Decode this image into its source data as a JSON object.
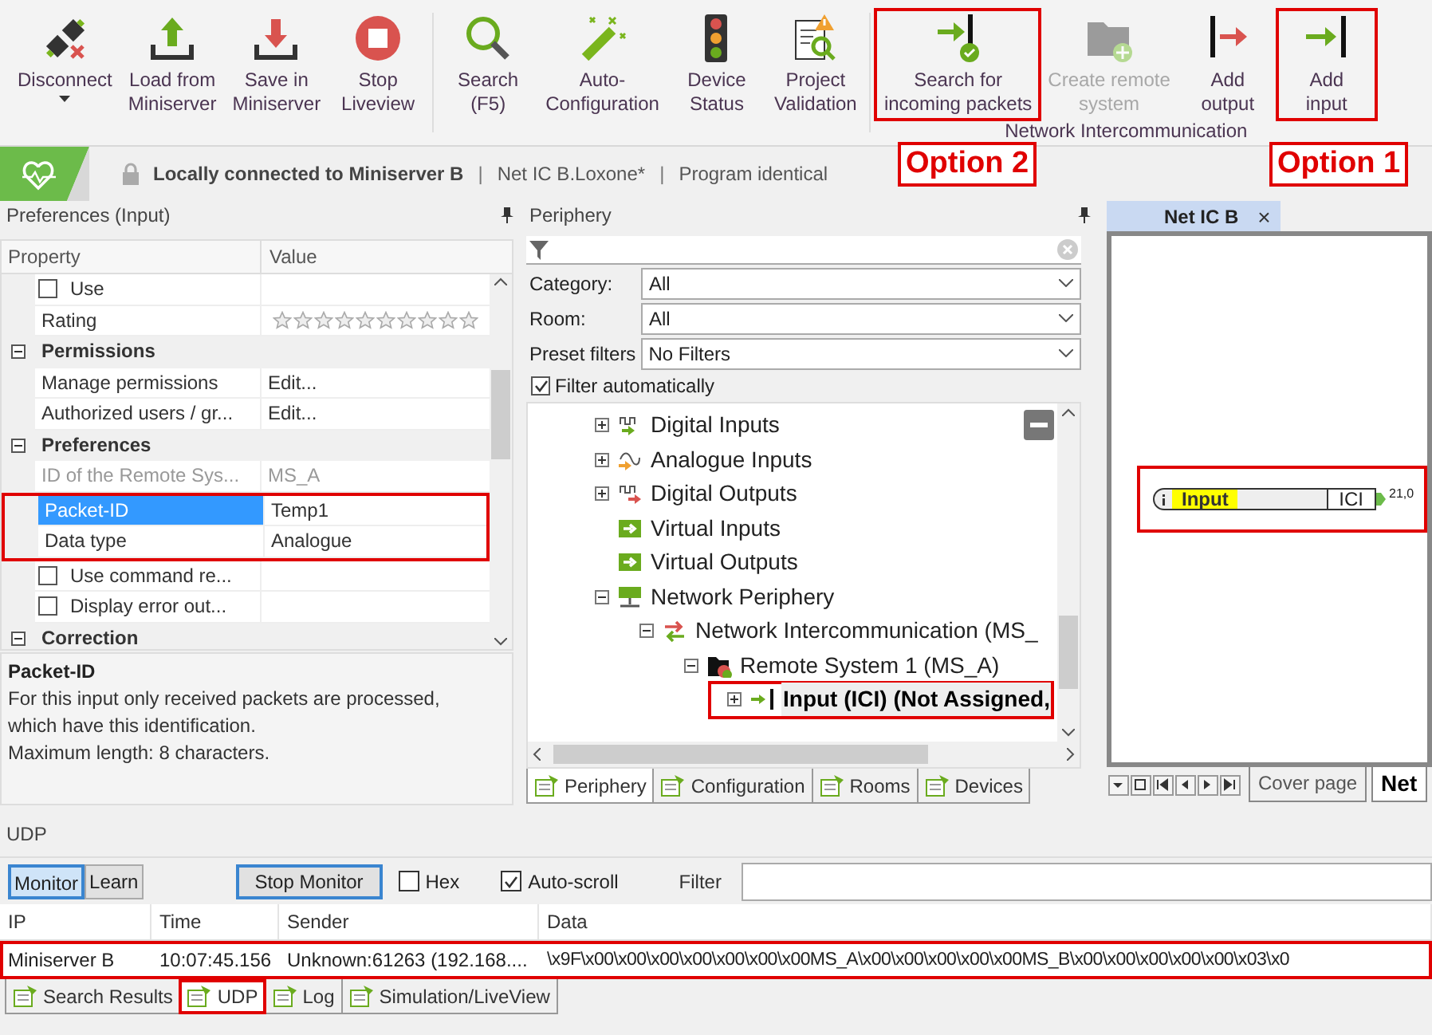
{
  "toolbar": {
    "groups": [
      {
        "buttons": [
          {
            "kind": "disconnect",
            "label": "Disconnect",
            "dropdown": true,
            "disabled": false,
            "highlighted": false
          },
          {
            "kind": "load",
            "label": "Load from\nMiniserver",
            "dropdown": false,
            "disabled": false,
            "highlighted": false
          },
          {
            "kind": "save",
            "label": "Save in\nMiniserver",
            "dropdown": false,
            "disabled": false,
            "highlighted": false
          },
          {
            "kind": "stop",
            "label": "Stop\nLiveview",
            "dropdown": false,
            "disabled": false,
            "highlighted": false
          }
        ]
      },
      {
        "buttons": [
          {
            "kind": "search",
            "label": "Search\n(F5)",
            "dropdown": false,
            "disabled": false,
            "highlighted": false
          },
          {
            "kind": "wand",
            "label": "Auto-\nConfiguration",
            "dropdown": false,
            "disabled": false,
            "highlighted": false
          },
          {
            "kind": "traffic",
            "label": "Device\nStatus",
            "dropdown": false,
            "disabled": false,
            "highlighted": false
          },
          {
            "kind": "validation",
            "label": "Project\nValidation",
            "dropdown": false,
            "disabled": false,
            "highlighted": false
          }
        ]
      },
      {
        "label": "Network Intercommunication",
        "buttons": [
          {
            "kind": "incoming",
            "label": "Search for\nincoming packets",
            "dropdown": false,
            "disabled": false,
            "highlighted": true
          },
          {
            "kind": "folder",
            "label": "Create remote\nsystem",
            "dropdown": false,
            "disabled": true,
            "highlighted": false
          },
          {
            "kind": "output",
            "label": "Add\noutput",
            "dropdown": false,
            "disabled": false,
            "highlighted": false
          },
          {
            "kind": "input",
            "label": "Add\ninput",
            "dropdown": false,
            "disabled": false,
            "highlighted": true
          }
        ]
      }
    ]
  },
  "annotations": [
    {
      "label": "Option 2"
    },
    {
      "label": "Option 1"
    }
  ],
  "status_bar": {
    "connection": "Locally connected to Miniserver B",
    "separator_1": "|",
    "project": "Net IC B.Loxone*",
    "separator_2": "|",
    "state": "Program identical"
  },
  "preferences": {
    "title": "Preferences (Input)",
    "columns": [
      "Property",
      "Value"
    ],
    "rows": [
      {
        "kind": "checkbox",
        "name": "Use",
        "checked": false
      },
      {
        "kind": "stars",
        "name": "Rating",
        "stars": 0
      },
      {
        "kind": "section",
        "name": "Permissions",
        "expanded": true
      },
      {
        "kind": "text",
        "name": "Manage permissions",
        "value": "Edit..."
      },
      {
        "kind": "text",
        "name": "Authorized users / gr...",
        "value": "Edit..."
      },
      {
        "kind": "section",
        "name": "Preferences",
        "expanded": true
      },
      {
        "kind": "text",
        "name": "ID of the Remote Sys...",
        "value": "MS_A",
        "disabled": true,
        "selected": false,
        "highlighted": false
      },
      {
        "kind": "text",
        "name": "Packet-ID",
        "value": "Temp1",
        "disabled": false,
        "selected": true,
        "highlighted": true
      },
      {
        "kind": "text",
        "name": "Data type",
        "value": "Analogue",
        "disabled": false,
        "selected": false,
        "highlighted": true
      },
      {
        "kind": "checkbox",
        "name": "Use command re...",
        "checked": false
      },
      {
        "kind": "checkbox",
        "name": "Display error out...",
        "checked": false
      },
      {
        "kind": "section",
        "name": "Correction",
        "expanded": true
      }
    ],
    "description": {
      "title": "Packet-ID",
      "text": "For this input only received packets are processed,\nwhich have this identification.\nMaximum length: 8 characters."
    }
  },
  "periphery": {
    "title": "Periphery",
    "filters": [
      {
        "label": "Category:",
        "value": "All"
      },
      {
        "label": "Room:",
        "value": "All"
      }
    ],
    "preset": {
      "label": "Preset filters",
      "value": "No Filters"
    },
    "filter_automatically": {
      "label": "Filter automatically",
      "checked": true
    },
    "tree": [
      {
        "kind": "digital-input",
        "label": "Digital Inputs",
        "expanded": false,
        "selected": false
      },
      {
        "kind": "analogue-input",
        "label": "Analogue Inputs",
        "expanded": false,
        "selected": false
      },
      {
        "kind": "digital-output",
        "label": "Digital Outputs",
        "expanded": false,
        "selected": false
      },
      {
        "kind": "virtual-input",
        "label": "Virtual Inputs",
        "selected": false
      },
      {
        "kind": "virtual-output",
        "label": "Virtual Outputs",
        "selected": false
      },
      {
        "kind": "network",
        "label": "Network Periphery",
        "expanded": true,
        "selected": false,
        "children": [
          {
            "kind": "intercom",
            "label": "Network Intercommunication (MS_",
            "expanded": true,
            "selected": false,
            "children": [
              {
                "kind": "remote-system",
                "label": "Remote System 1  (MS_A)",
                "expanded": true,
                "selected": false,
                "children": [
                  {
                    "kind": "ici-input",
                    "label": "Input (ICI)  (Not Assigned,",
                    "expanded": false,
                    "selected": true,
                    "highlighted": true
                  }
                ]
              }
            ]
          }
        ]
      }
    ],
    "tabs": [
      {
        "label": "Periphery",
        "selected": true
      },
      {
        "label": "Configuration",
        "selected": false
      },
      {
        "label": "Rooms",
        "selected": false
      },
      {
        "label": "Devices",
        "selected": false
      }
    ]
  },
  "document": {
    "tab": {
      "label": "Net IC B",
      "close": "×"
    },
    "block": {
      "label": "Input",
      "type": "ICI",
      "value": "21,0",
      "highlighted": true
    },
    "pages": [
      {
        "label": "Cover page",
        "selected": false
      },
      {
        "label": "Net",
        "selected": true
      }
    ]
  },
  "udp": {
    "title": "UDP",
    "buttons": [
      {
        "label": "Monitor",
        "selected": true
      },
      {
        "label": "Learn",
        "selected": false
      }
    ],
    "stop_button": "Stop Monitor",
    "hex": {
      "label": "Hex",
      "checked": false
    },
    "autoscroll": {
      "label": "Auto-scroll",
      "checked": true
    },
    "filter": {
      "label": "Filter"
    },
    "columns": [
      "IP",
      "Time",
      "Sender",
      "Data"
    ],
    "rows": [
      {
        "cells": [
          "Miniserver B",
          "10:07:45.156",
          "Unknown:61263 (192.168....",
          "\\x9F\\x00\\x00\\x00\\x00\\x00\\x00\\x00MS_A\\x00\\x00\\x00\\x00\\x00MS_B\\x00\\x00\\x00\\x00\\x00\\x03\\x0"
        ],
        "highlighted": true
      }
    ]
  },
  "bottom_tabs": [
    {
      "label": "Search Results",
      "selected": false,
      "highlighted": false
    },
    {
      "label": "UDP",
      "selected": true,
      "highlighted": true
    },
    {
      "label": "Log",
      "selected": false,
      "highlighted": false
    },
    {
      "label": "Simulation/LiveView",
      "selected": false,
      "highlighted": false
    }
  ]
}
